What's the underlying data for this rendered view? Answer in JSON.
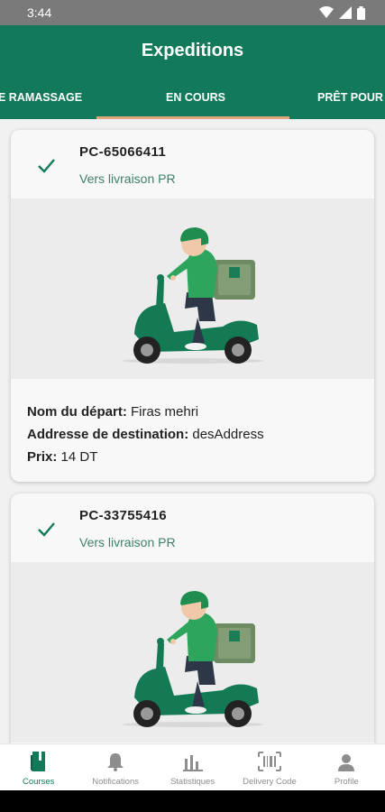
{
  "status_bar": {
    "time": "3:44"
  },
  "app_bar": {
    "title": "Expeditions"
  },
  "tabs": [
    {
      "label": "E RAMASSAGE"
    },
    {
      "label": "EN COURS"
    },
    {
      "label": "PRÊT POUR L"
    }
  ],
  "active_tab": 1,
  "colors": {
    "primary": "#127a5b",
    "tab_indicator": "#e3a57a",
    "check": "#127a5b",
    "status_text": "#3f7f6b"
  },
  "cards": [
    {
      "code": "PC-65066411",
      "status": "Vers livraison PR",
      "depart_label": "Nom du départ:",
      "depart_value": "Firas mehri",
      "dest_label": "Addresse de destination:",
      "dest_value": "desAddress",
      "price_label": "Prix:",
      "price_value": "14 DT",
      "icon": "check-icon"
    },
    {
      "code": "PC-33755416",
      "status": "Vers livraison PR",
      "icon": "check-icon"
    }
  ],
  "bottom_nav": [
    {
      "label": "Courses",
      "icon": "courses-icon",
      "active": true
    },
    {
      "label": "Notifications",
      "icon": "bell-icon",
      "active": false
    },
    {
      "label": "Statistiques",
      "icon": "bar-chart-icon",
      "active": false
    },
    {
      "label": "Delivery Code",
      "icon": "barcode-icon",
      "active": false
    },
    {
      "label": "Profile",
      "icon": "person-icon",
      "active": false
    }
  ]
}
